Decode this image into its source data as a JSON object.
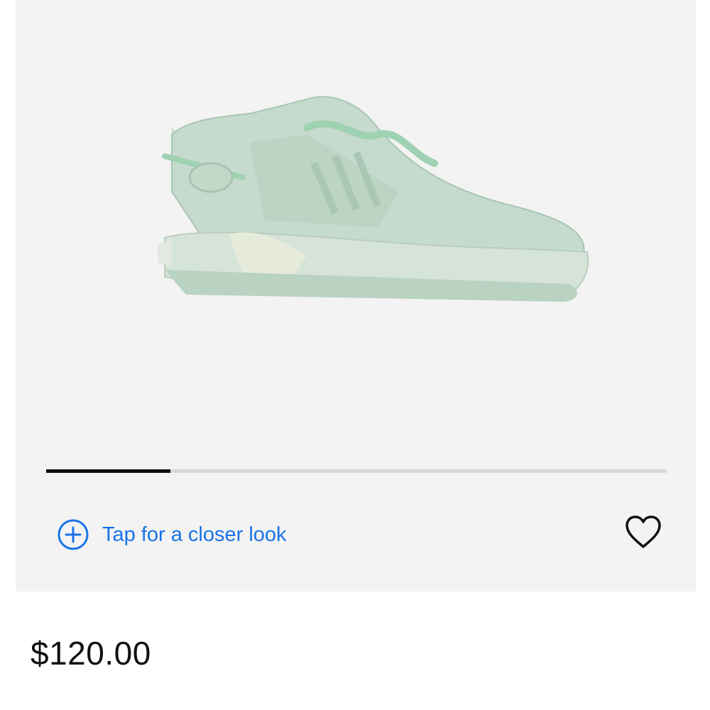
{
  "gallery": {
    "image_alt": "Mint green sneaker",
    "progress": 0.2,
    "closer_look_label": "Tap for a closer look"
  },
  "product": {
    "price": "$120.00"
  },
  "icons": {
    "zoom": "plus-circle-icon",
    "wishlist": "heart-outline-icon"
  },
  "colors": {
    "accent": "#1a73e8",
    "gallery_bg": "#f3f3f3",
    "progress_fill": "#111111",
    "progress_track": "#d9d9d9"
  }
}
